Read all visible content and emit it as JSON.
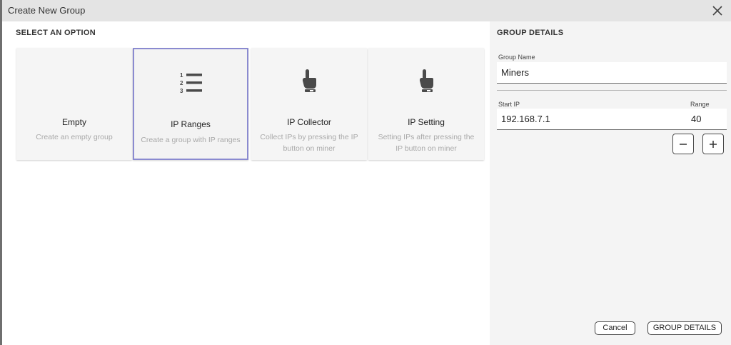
{
  "dialog": {
    "title": "Create New Group"
  },
  "options": {
    "section_title": "SELECT AN OPTION",
    "cards": [
      {
        "title": "Empty",
        "description": "Create an empty group",
        "icon": "none",
        "selected": false
      },
      {
        "title": "IP Ranges",
        "description": "Create a group with IP ranges",
        "icon": "numbered-list-icon",
        "selected": true
      },
      {
        "title": "IP Collector",
        "description": "Collect IPs by pressing the IP button on miner",
        "icon": "hand-pointer-icon",
        "selected": false
      },
      {
        "title": "IP Setting",
        "description": "Setting IPs after pressing the IP button on miner",
        "icon": "hand-pointer-icon",
        "selected": false
      }
    ]
  },
  "details": {
    "section_title": "GROUP DETAILS",
    "group_name_label": "Group Name",
    "group_name_value": "Miners",
    "start_ip_label": "Start IP",
    "start_ip_value": "192.168.7.1",
    "range_label": "Range",
    "range_value": "40"
  },
  "footer": {
    "cancel_label": "Cancel",
    "submit_label": "GROUP DETAILS"
  },
  "colors": {
    "titlebar": "#e4e4e4",
    "selected_border": "#8a8ad0",
    "right_panel": "#f4f4f4",
    "icon": "#4a4a4a"
  }
}
